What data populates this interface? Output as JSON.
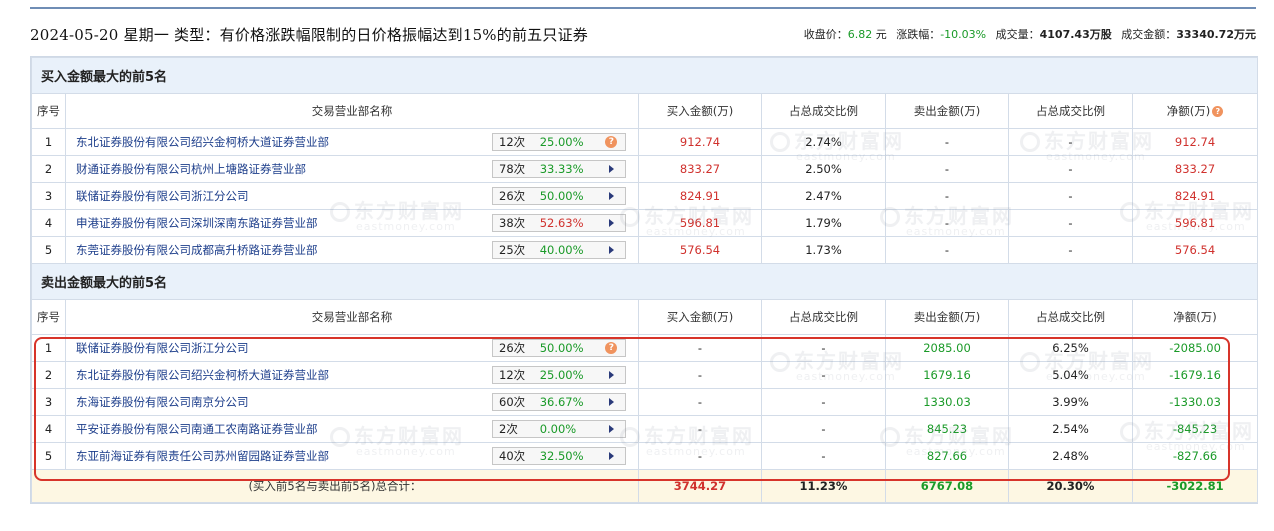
{
  "header": {
    "title": "2024-05-20 星期一 类型：有价格涨跌幅限制的日价格振幅达到15%的前五只证券",
    "close_label": "收盘价：",
    "close_value": "6.82",
    "close_unit": "元",
    "change_label": "涨跌幅：",
    "change_value": "-10.03%",
    "volume_label": "成交量：",
    "volume_value": "4107.43万股",
    "turnover_label": "成交金额：",
    "turnover_value": "33340.72万元"
  },
  "columns": {
    "rank": "序号",
    "dept": "交易营业部名称",
    "buy_amount": "买入金额(万)",
    "buy_ratio": "占总成交比例",
    "sell_amount": "卖出金额(万)",
    "sell_ratio": "占总成交比例",
    "net": "净额(万)"
  },
  "watermark": {
    "cn": "东方财富网",
    "en": "eastmoney.com"
  },
  "buy_section": {
    "title": "买入金额最大的前5名",
    "rows": [
      {
        "rank": "1",
        "name": "东北证券股份有限公司绍兴金柯桥大道证券营业部",
        "count": "12次",
        "rate": "25.00%",
        "rate_color": "green",
        "icon": "question",
        "buy": "912.74",
        "buy_ratio": "2.74%",
        "sell": "-",
        "sell_ratio": "-",
        "net": "912.74"
      },
      {
        "rank": "2",
        "name": "财通证券股份有限公司杭州上塘路证券营业部",
        "count": "78次",
        "rate": "33.33%",
        "rate_color": "green",
        "icon": "play",
        "buy": "833.27",
        "buy_ratio": "2.50%",
        "sell": "-",
        "sell_ratio": "-",
        "net": "833.27"
      },
      {
        "rank": "3",
        "name": "联储证券股份有限公司浙江分公司",
        "count": "26次",
        "rate": "50.00%",
        "rate_color": "green",
        "icon": "play",
        "buy": "824.91",
        "buy_ratio": "2.47%",
        "sell": "-",
        "sell_ratio": "-",
        "net": "824.91"
      },
      {
        "rank": "4",
        "name": "申港证券股份有限公司深圳深南东路证券营业部",
        "count": "38次",
        "rate": "52.63%",
        "rate_color": "red",
        "icon": "play",
        "buy": "596.81",
        "buy_ratio": "1.79%",
        "sell": "-",
        "sell_ratio": "-",
        "net": "596.81"
      },
      {
        "rank": "5",
        "name": "东莞证券股份有限公司成都高升桥路证券营业部",
        "count": "25次",
        "rate": "40.00%",
        "rate_color": "green",
        "icon": "play",
        "buy": "576.54",
        "buy_ratio": "1.73%",
        "sell": "-",
        "sell_ratio": "-",
        "net": "576.54"
      }
    ]
  },
  "sell_section": {
    "title": "卖出金额最大的前5名",
    "rows": [
      {
        "rank": "1",
        "name": "联储证券股份有限公司浙江分公司",
        "count": "26次",
        "rate": "50.00%",
        "rate_color": "green",
        "icon": "question",
        "buy": "-",
        "buy_ratio": "-",
        "sell": "2085.00",
        "sell_ratio": "6.25%",
        "net": "-2085.00"
      },
      {
        "rank": "2",
        "name": "东北证券股份有限公司绍兴金柯桥大道证券营业部",
        "count": "12次",
        "rate": "25.00%",
        "rate_color": "green",
        "icon": "play",
        "buy": "-",
        "buy_ratio": "-",
        "sell": "1679.16",
        "sell_ratio": "5.04%",
        "net": "-1679.16"
      },
      {
        "rank": "3",
        "name": "东海证券股份有限公司南京分公司",
        "count": "60次",
        "rate": "36.67%",
        "rate_color": "green",
        "icon": "play",
        "buy": "-",
        "buy_ratio": "-",
        "sell": "1330.03",
        "sell_ratio": "3.99%",
        "net": "-1330.03"
      },
      {
        "rank": "4",
        "name": "平安证券股份有限公司南通工农南路证券营业部",
        "count": "2次",
        "rate": "0.00%",
        "rate_color": "green",
        "icon": "play",
        "buy": "-",
        "buy_ratio": "-",
        "sell": "845.23",
        "sell_ratio": "2.54%",
        "net": "-845.23"
      },
      {
        "rank": "5",
        "name": "东亚前海证券有限责任公司苏州留园路证券营业部",
        "count": "40次",
        "rate": "32.50%",
        "rate_color": "green",
        "icon": "play",
        "buy": "-",
        "buy_ratio": "-",
        "sell": "827.66",
        "sell_ratio": "2.48%",
        "net": "-827.66"
      }
    ]
  },
  "total": {
    "label": "(买入前5名与卖出前5名)总合计：",
    "buy": "3744.27",
    "buy_ratio": "11.23%",
    "sell": "6767.08",
    "sell_ratio": "20.30%",
    "net": "-3022.81"
  },
  "colors": {
    "red": "#d0312d",
    "green": "#1a9a28",
    "link": "#1d3e8b",
    "section_bg": "#e9f1fa",
    "total_bg": "#fdf7e3",
    "highlight": "#d7342a"
  }
}
